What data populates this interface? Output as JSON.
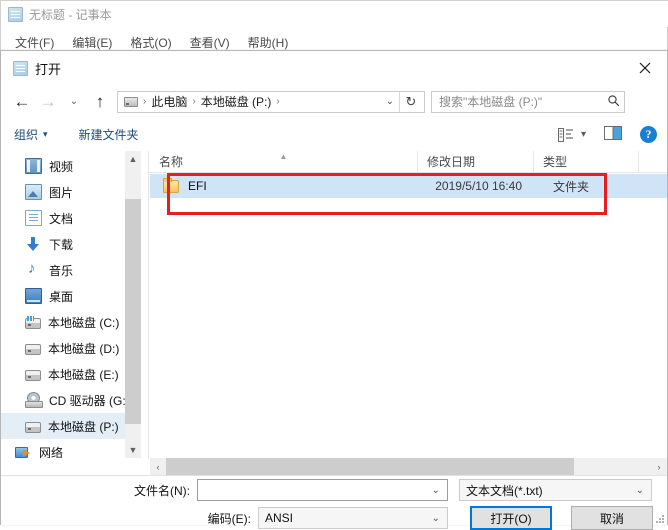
{
  "notepad": {
    "title": "无标题 - 记事本",
    "icon": "notepad-icon",
    "menu": [
      {
        "label": "文件(F)"
      },
      {
        "label": "编辑(E)"
      },
      {
        "label": "格式(O)"
      },
      {
        "label": "查看(V)"
      },
      {
        "label": "帮助(H)"
      }
    ]
  },
  "dialog": {
    "title": "打开",
    "icon": "notepad-icon",
    "close_label": "✕"
  },
  "nav": {
    "back_icon": "arrow-left-icon",
    "forward_icon": "arrow-right-icon",
    "recent_icon": "chevron-down-icon",
    "up_icon": "arrow-up-icon",
    "refresh_icon": "refresh-icon",
    "breadcrumb": {
      "drive_icon": "drive-icon",
      "items": [
        "此电脑",
        "本地磁盘 (P:)"
      ],
      "separator": "›",
      "trailing_separator": "›",
      "dropdown_icon": "chevron-down-icon"
    },
    "search": {
      "placeholder": "搜索\"本地磁盘 (P:)\"",
      "value": "",
      "icon": "search-icon"
    }
  },
  "toolbar": {
    "organize_label": "组织",
    "organize_caret": "▾",
    "new_folder_label": "新建文件夹",
    "view_options_icon": "view-list-icon",
    "view_options_caret": "▾",
    "preview_pane_icon": "preview-pane-icon",
    "help_icon": "help-icon",
    "help_glyph": "?"
  },
  "navigation_pane": {
    "items": [
      {
        "label": "视频",
        "icon": "video-icon",
        "selected": false
      },
      {
        "label": "图片",
        "icon": "pictures-icon",
        "selected": false
      },
      {
        "label": "文档",
        "icon": "documents-icon",
        "selected": false
      },
      {
        "label": "下载",
        "icon": "downloads-icon",
        "selected": false
      },
      {
        "label": "音乐",
        "icon": "music-icon",
        "selected": false
      },
      {
        "label": "桌面",
        "icon": "desktop-icon",
        "selected": false
      },
      {
        "label": "本地磁盘 (C:)",
        "icon": "system-drive-icon",
        "selected": false
      },
      {
        "label": "本地磁盘 (D:)",
        "icon": "drive-icon",
        "selected": false
      },
      {
        "label": "本地磁盘 (E:)",
        "icon": "drive-icon",
        "selected": false
      },
      {
        "label": "CD 驱动器 (G:)",
        "icon": "cd-drive-icon",
        "selected": false
      },
      {
        "label": "本地磁盘 (P:)",
        "icon": "drive-icon",
        "selected": true
      },
      {
        "label": "网络",
        "icon": "network-icon",
        "selected": false
      }
    ],
    "scrollbar": {
      "up": "▲",
      "down": "▼"
    }
  },
  "file_list": {
    "columns": [
      {
        "label": "名称",
        "sorted": true,
        "sort_caret": "▲"
      },
      {
        "label": "修改日期",
        "sorted": false
      },
      {
        "label": "类型",
        "sorted": false
      }
    ],
    "rows": [
      {
        "name": "EFI",
        "date": "2019/5/10 16:40",
        "type": "文件夹",
        "icon": "folder-icon",
        "selected": true
      }
    ],
    "hscrollbar": {
      "left": "‹",
      "right": "›"
    }
  },
  "annotation": {
    "color": "#e81d1d",
    "shape": "rectangle",
    "targets": "EFI folder row"
  },
  "footer": {
    "filename_label": "文件名(N):",
    "filename_value": "",
    "filetype_value": "文本文档(*.txt)",
    "encoding_label": "编码(E):",
    "encoding_value": "ANSI",
    "open_button": "打开(O)",
    "cancel_button": "取消",
    "caret": "⌄"
  }
}
